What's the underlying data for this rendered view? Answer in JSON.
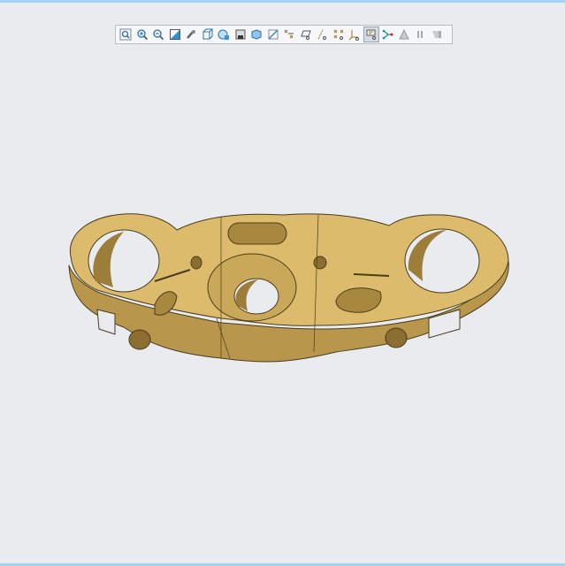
{
  "toolbar": {
    "buttons": [
      {
        "icon": "refit-icon"
      },
      {
        "icon": "zoom-in-icon"
      },
      {
        "icon": "zoom-out-icon"
      },
      {
        "icon": "repaint-icon"
      },
      {
        "icon": "spin-center-icon"
      },
      {
        "icon": "saved-orientations-icon"
      },
      {
        "icon": "view-manager-icon"
      },
      {
        "icon": "display-style-icon"
      },
      {
        "icon": "shaded-view-icon"
      },
      {
        "icon": "section-icon"
      },
      {
        "icon": "datum-display-icon"
      },
      {
        "icon": "plane-display-icon"
      },
      {
        "icon": "axis-display-icon"
      },
      {
        "icon": "point-display-icon"
      },
      {
        "icon": "csys-display-icon"
      },
      {
        "icon": "annotation-display-icon",
        "active": true
      },
      {
        "icon": "connect-icon"
      },
      {
        "icon": "triangle-icon"
      },
      {
        "icon": "pause-icon"
      },
      {
        "icon": "stop-icon"
      }
    ]
  },
  "model": {
    "color": "#d9b96a",
    "edge": "#4a3c1c",
    "shade": "#b8974c"
  }
}
